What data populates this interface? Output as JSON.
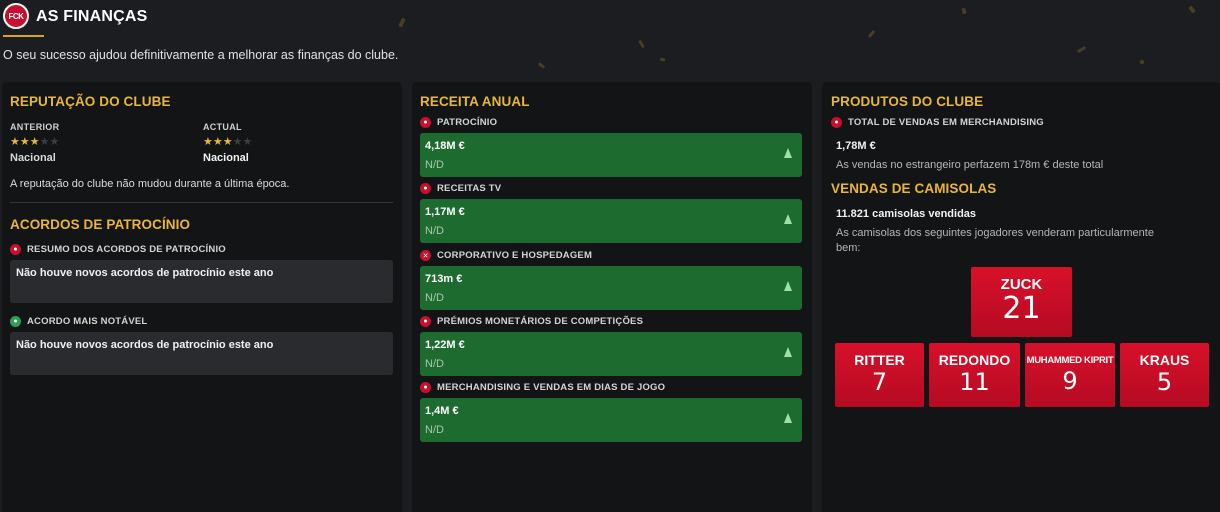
{
  "header": {
    "logo_text": "FCK",
    "title": "AS FINANÇAS",
    "subtitle": "O seu sucesso ajudou definitivamente a melhorar as finanças do clube."
  },
  "reputation": {
    "title": "REPUTAÇÃO DO CLUBE",
    "previous_label": "ANTERIOR",
    "previous_value": "Nacional",
    "previous_stars": 3,
    "current_label": "ACTUAL",
    "current_value": "Nacional",
    "current_stars": 3,
    "max_stars": 5,
    "note": "A reputação do clube não mudou durante a última época."
  },
  "sponsorship": {
    "title": "ACORDOS DE PATROCÍNIO",
    "summary_label": "RESUMO DOS ACORDOS DE PATROCÍNIO",
    "summary_text": "Não houve novos acordos de patrocínio este ano",
    "notable_label": "ACORDO MAIS NOTÁVEL",
    "notable_text": "Não houve novos acordos de patrocínio este ano"
  },
  "revenue": {
    "title": "RECEITA ANUAL",
    "items": [
      {
        "label": "PATROCÍNIO",
        "value": "4,18M €",
        "sub": "N/D"
      },
      {
        "label": "RECEITAS TV",
        "value": "1,17M €",
        "sub": "N/D"
      },
      {
        "label": "CORPORATIVO E HOSPEDAGEM",
        "value": "713m €",
        "sub": "N/D"
      },
      {
        "label": "PRÉMIOS MONETÁRIOS DE COMPETIÇÕES",
        "value": "1,22M €",
        "sub": "N/D"
      },
      {
        "label": "MERCHANDISING E VENDAS EM DIAS DE JOGO",
        "value": "1,4M €",
        "sub": "N/D"
      }
    ]
  },
  "products": {
    "title": "PRODUTOS DO CLUBE",
    "merch_label": "TOTAL DE VENDAS EM MERCHANDISING",
    "merch_value": "1,78M €",
    "merch_note": "As vendas no estrangeiro perfazem 178m € deste total"
  },
  "shirts": {
    "title": "VENDAS DE CAMISOLAS",
    "count_text": "11.821 camisolas vendidas",
    "note": "As camisolas dos seguintes jogadores venderam particularmente bem:",
    "players": [
      {
        "name": "ZUCK",
        "number": "21"
      },
      {
        "name": "RITTER",
        "number": "7"
      },
      {
        "name": "REDONDO",
        "number": "11"
      },
      {
        "name": "MUHAMMED KIPRIT",
        "number": "9"
      },
      {
        "name": "KRAUS",
        "number": "5"
      }
    ]
  },
  "colors": {
    "accent": "#e8b739",
    "brand_red": "#c8102e",
    "revenue_green": "#1e6b30",
    "background": "#1c1d20",
    "panel": "#131416"
  },
  "icons": {
    "club_logo": "club-crest-icon",
    "category": "category-badge-icon",
    "trend": "trend-up-icon"
  }
}
